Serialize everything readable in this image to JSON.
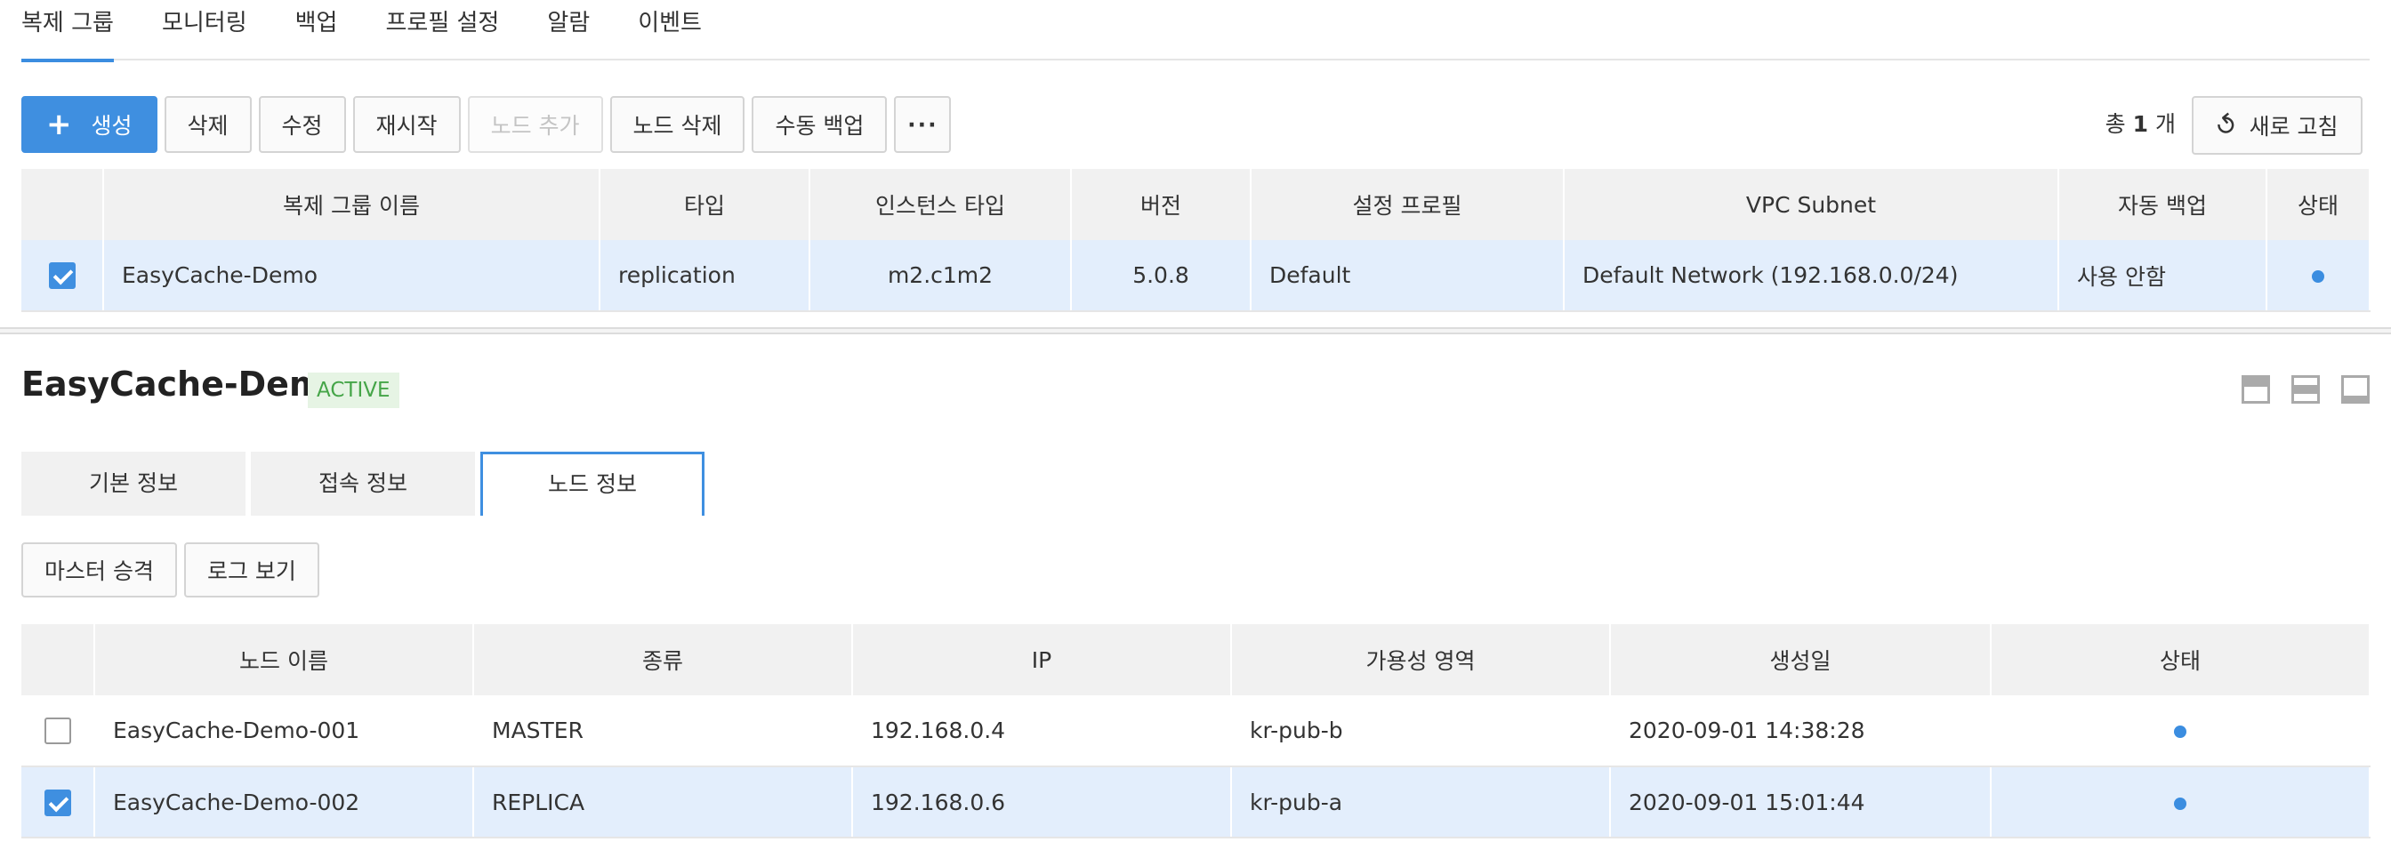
{
  "top_tabs": [
    "복제 그룹",
    "모니터링",
    "백업",
    "프로필 설정",
    "알람",
    "이벤트"
  ],
  "toolbar": {
    "create": "생성",
    "delete": "삭제",
    "modify": "수정",
    "restart": "재시작",
    "add_node": "노드 추가",
    "delete_node": "노드 삭제",
    "manual_backup": "수동 백업",
    "more": "···"
  },
  "count": {
    "prefix": "총",
    "value": "1",
    "suffix": "개"
  },
  "refresh_label": "새로 고침",
  "group_table": {
    "headers": [
      "복제 그룹 이름",
      "타입",
      "인스턴스 타입",
      "버전",
      "설정 프로필",
      "VPC Subnet",
      "자동 백업",
      "상태"
    ],
    "rows": [
      {
        "checked": true,
        "name": "EasyCache-Demo",
        "type": "replication",
        "instance_type": "m2.c1m2",
        "version": "5.0.8",
        "profile": "Default",
        "subnet": "Default Network (192.168.0.0/24)",
        "auto_backup": "사용 안함"
      }
    ]
  },
  "detail": {
    "title": "EasyCache-Demo",
    "status": "ACTIVE",
    "tabs": [
      "기본 정보",
      "접속 정보",
      "노드 정보"
    ],
    "active_tab": "노드 정보",
    "actions": {
      "promote": "마스터 승격",
      "view_log": "로그 보기"
    }
  },
  "node_table": {
    "headers": [
      "노드 이름",
      "종류",
      "IP",
      "가용성 영역",
      "생성일",
      "상태"
    ],
    "rows": [
      {
        "checked": false,
        "name": "EasyCache-Demo-001",
        "kind": "MASTER",
        "ip": "192.168.0.4",
        "zone": "kr-pub-b",
        "created": "2020-09-01 14:38:28"
      },
      {
        "checked": true,
        "name": "EasyCache-Demo-002",
        "kind": "REPLICA",
        "ip": "192.168.0.6",
        "zone": "kr-pub-a",
        "created": "2020-09-01 15:01:44"
      }
    ]
  },
  "colors": {
    "accent": "#3f8fe0",
    "status_active": "#45a548",
    "selected_row": "#e3eefc"
  }
}
